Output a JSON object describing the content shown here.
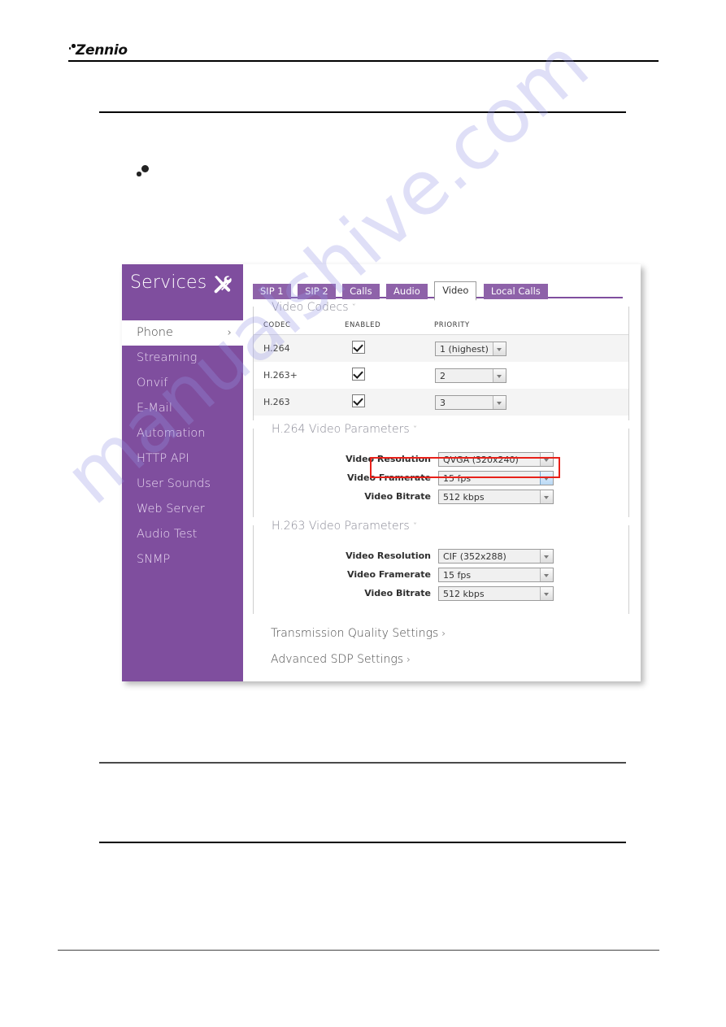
{
  "page": {
    "brand": "Zennio",
    "watermark": "manualshive.com"
  },
  "app": {
    "sidebar": {
      "title": "Services",
      "tools_icon": "tools-icon",
      "items": [
        {
          "label": "Phone",
          "active": true,
          "chevron": "›"
        },
        {
          "label": "Streaming",
          "active": false
        },
        {
          "label": "Onvif",
          "active": false
        },
        {
          "label": "E-Mail",
          "active": false
        },
        {
          "label": "Automation",
          "active": false
        },
        {
          "label": "HTTP API",
          "active": false
        },
        {
          "label": "User Sounds",
          "active": false
        },
        {
          "label": "Web Server",
          "active": false
        },
        {
          "label": "Audio Test",
          "active": false
        },
        {
          "label": "SNMP",
          "active": false
        }
      ]
    },
    "tabs": [
      {
        "label": "SIP 1",
        "active": false
      },
      {
        "label": "SIP 2",
        "active": false
      },
      {
        "label": "Calls",
        "active": false
      },
      {
        "label": "Audio",
        "active": false
      },
      {
        "label": "Video",
        "active": true
      },
      {
        "label": "Local Calls",
        "active": false
      }
    ],
    "video_codecs": {
      "title": "Video Codecs",
      "caret": "ˇ",
      "columns": [
        "CODEC",
        "ENABLED",
        "PRIORITY"
      ],
      "rows": [
        {
          "codec": "H.264",
          "enabled": true,
          "priority": "1 (highest)"
        },
        {
          "codec": "H.263+",
          "enabled": true,
          "priority": "2"
        },
        {
          "codec": "H.263",
          "enabled": true,
          "priority": "3"
        }
      ]
    },
    "h264_params": {
      "title": "H.264 Video Parameters",
      "caret": "ˇ",
      "rows": [
        {
          "label": "Video Resolution",
          "value": "QVGA (320x240)",
          "highlighted": true
        },
        {
          "label": "Video Framerate",
          "value": "15 fps",
          "focused": true
        },
        {
          "label": "Video Bitrate",
          "value": "512 kbps"
        }
      ]
    },
    "h263_params": {
      "title": "H.263 Video Parameters",
      "caret": "ˇ",
      "rows": [
        {
          "label": "Video Resolution",
          "value": "CIF (352x288)"
        },
        {
          "label": "Video Framerate",
          "value": "15 fps"
        },
        {
          "label": "Video Bitrate",
          "value": "512 kbps"
        }
      ]
    },
    "collapsed_sections": [
      {
        "label": "Transmission Quality Settings",
        "caret": "›"
      },
      {
        "label": "Advanced SDP Settings",
        "caret": "›"
      }
    ],
    "colors": {
      "sidebar_purple": "#7f4e9e",
      "tab_purple": "#8e62a9",
      "highlight_red": "#e8211a"
    }
  }
}
